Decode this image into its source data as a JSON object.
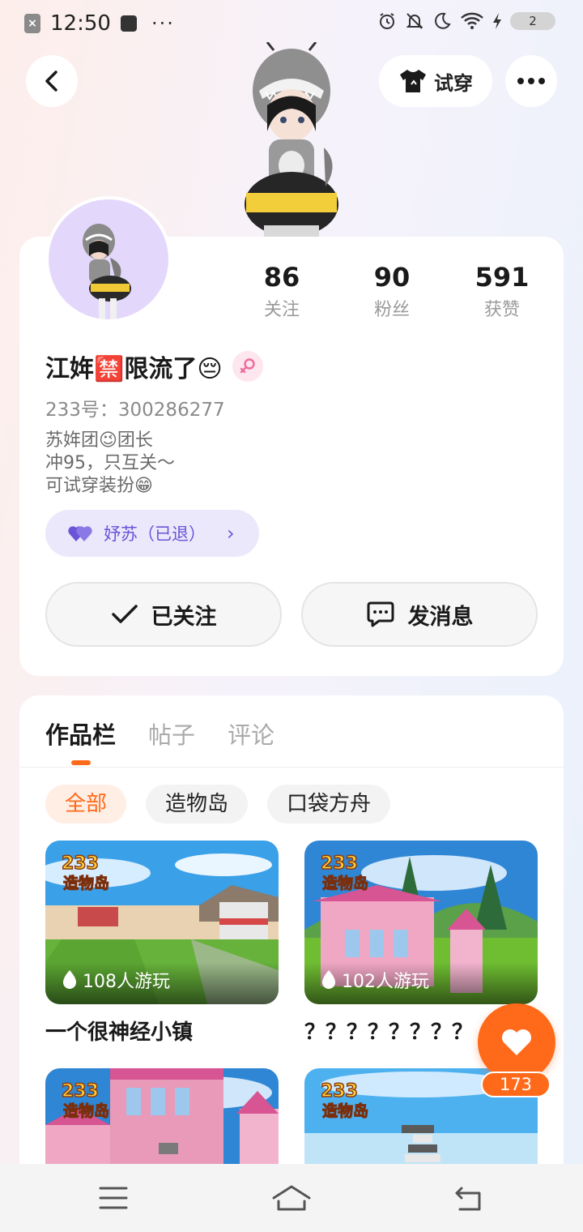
{
  "status_bar": {
    "time": "12:50",
    "more": "···",
    "battery": "2"
  },
  "header": {
    "tryon_label": "试穿"
  },
  "profile": {
    "name": "江姩🈲限流了😔",
    "uid": "233号：300286277",
    "bio": [
      "苏姩团😉团长",
      "冲95，只互关～",
      "可试穿装扮😁"
    ],
    "group_tag": "妤苏（已退）",
    "stats": [
      {
        "value": "86",
        "label": "关注"
      },
      {
        "value": "90",
        "label": "粉丝"
      },
      {
        "value": "591",
        "label": "获赞"
      }
    ],
    "follow_label": "已关注",
    "message_label": "发消息"
  },
  "works": {
    "tabs": [
      "作品栏",
      "帖子",
      "评论"
    ],
    "chips": [
      "全部",
      "造物岛",
      "口袋方舟"
    ],
    "logo_number": "233",
    "logo_text": "造物岛",
    "games": [
      {
        "title": "一个很神经小镇",
        "plays": "108人游玩"
      },
      {
        "title": "？？？？？？？？",
        "plays": "102人游玩"
      },
      {
        "title": "",
        "plays": ""
      },
      {
        "title": "",
        "plays": ""
      }
    ]
  },
  "like": {
    "count": "173"
  },
  "colors": {
    "accent": "#ff6a1a",
    "group_purple": "#6a55d8"
  },
  "icons": [
    "back-icon",
    "shirt-icon",
    "more-icon",
    "female-icon",
    "heart-icon",
    "check-icon",
    "chat-icon",
    "fire-icon",
    "menu-icon",
    "home-icon",
    "return-icon"
  ]
}
